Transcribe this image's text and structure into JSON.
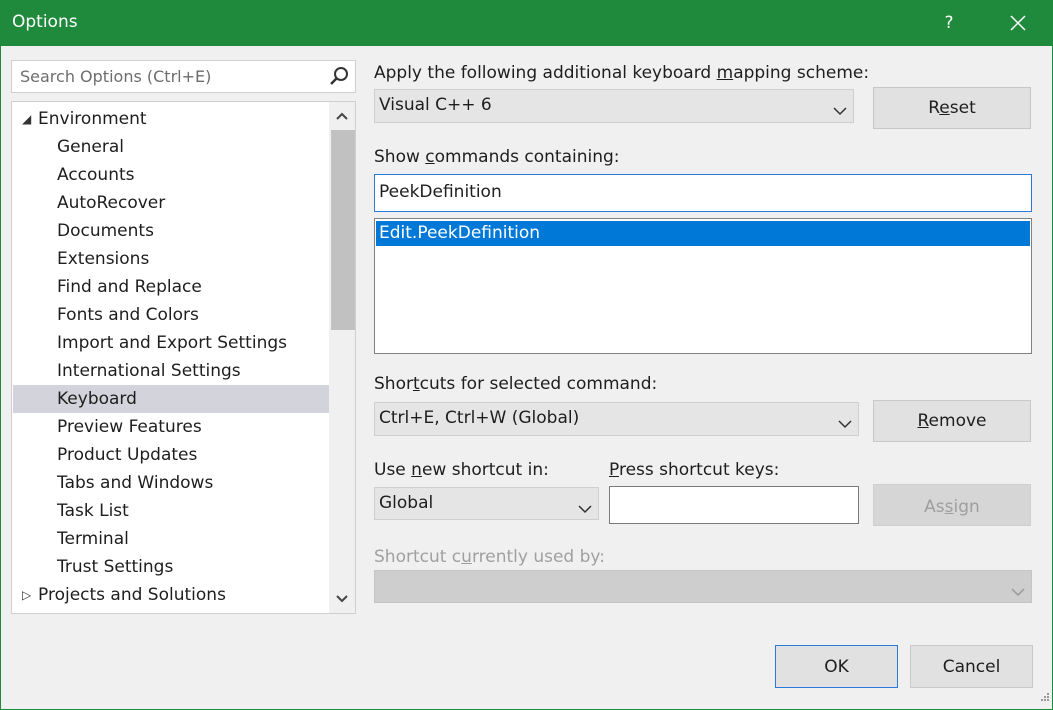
{
  "window": {
    "title": "Options",
    "help_label": "?",
    "accent": "#1f8a3b"
  },
  "search": {
    "placeholder": "Search Options (Ctrl+E)",
    "icon": "search-icon"
  },
  "tree": {
    "items": [
      {
        "label": "Environment",
        "type": "parent",
        "expanded": true
      },
      {
        "label": "General"
      },
      {
        "label": "Accounts"
      },
      {
        "label": "AutoRecover"
      },
      {
        "label": "Documents"
      },
      {
        "label": "Extensions"
      },
      {
        "label": "Find and Replace"
      },
      {
        "label": "Fonts and Colors"
      },
      {
        "label": "Import and Export Settings"
      },
      {
        "label": "International Settings"
      },
      {
        "label": "Keyboard",
        "selected": true
      },
      {
        "label": "Preview Features"
      },
      {
        "label": "Product Updates"
      },
      {
        "label": "Tabs and Windows"
      },
      {
        "label": "Task List"
      },
      {
        "label": "Terminal"
      },
      {
        "label": "Trust Settings"
      },
      {
        "label": "Projects and Solutions",
        "type": "parent",
        "expanded": false
      }
    ]
  },
  "keyboard": {
    "mapping_label_pre": "Apply the following additional keyboard ",
    "mapping_label_key": "m",
    "mapping_label_post": "apping scheme:",
    "mapping_value": "Visual C++ 6",
    "reset_pre": "R",
    "reset_key": "e",
    "reset_post": "set",
    "show_label_pre": "Show ",
    "show_label_key": "c",
    "show_label_post": "ommands containing:",
    "filter_value": "PeekDefinition",
    "commands": [
      "Edit.PeekDefinition"
    ],
    "shortcuts_label_pre": "Shor",
    "shortcuts_label_key": "t",
    "shortcuts_label_post": "cuts for selected command:",
    "shortcut_value": "Ctrl+E, Ctrl+W (Global)",
    "remove_key": "R",
    "remove_post": "emove",
    "use_label_pre": "Use ",
    "use_label_key": "n",
    "use_label_post": "ew shortcut in:",
    "scope_value": "Global",
    "press_label_key": "P",
    "press_label_post": "ress shortcut keys:",
    "press_value": "",
    "assign_pre": "As",
    "assign_key": "s",
    "assign_post": "ign",
    "used_by_pre": "Shortcut c",
    "used_by_key": "u",
    "used_by_post": "rrently used by:",
    "used_by_value": ""
  },
  "footer": {
    "ok_label": "OK",
    "cancel_label": "Cancel"
  }
}
